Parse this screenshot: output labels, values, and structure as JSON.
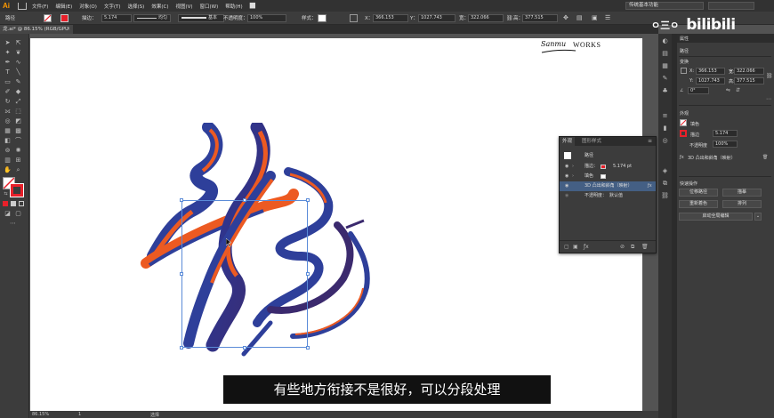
{
  "app": {
    "logo": "Ai",
    "document_tab": "龙.ai* @ 86.15% (RGB/GPU 预览)"
  },
  "menu": [
    "文件(F)",
    "编辑(E)",
    "对象(O)",
    "文字(T)",
    "选择(S)",
    "效果(C)",
    "视图(V)",
    "窗口(W)",
    "帮助(H)"
  ],
  "menu_extra": "█▌",
  "workspace": "传统基本功能",
  "control_bar": {
    "label": "路径",
    "stroke_label": "描边：",
    "stroke_value": "5.174",
    "stroke_style": "均匀",
    "brush": "基本",
    "opacity_label": "不透明度：",
    "opacity_value": "100%",
    "style_label": "样式：",
    "x_label": "X：",
    "x": "366.153",
    "y_label": "Y：",
    "y": "1027.743",
    "w_label": "宽：",
    "w": "322.066",
    "h_label": "高：",
    "h": "377.515"
  },
  "status_bar": {
    "zoom": "86.15%",
    "page": "1",
    "tool": "选择"
  },
  "signature": {
    "script": "Sanmu",
    "text": "WORKS"
  },
  "appearance_panel": {
    "tab_active": "外观",
    "tab_other": "图形样式",
    "object_label": "路径",
    "rows": [
      {
        "label": "描边：",
        "value": "5.174 pt"
      },
      {
        "label": "填色",
        "value": ""
      },
      {
        "label": "3D 凸出和斜角（映射）",
        "value": ""
      },
      {
        "label": "不透明度：",
        "value": "默认值"
      }
    ]
  },
  "properties": {
    "tab": "属性",
    "selection": "路径",
    "transform_title": "变换",
    "x": "366.153",
    "y": "1027.743",
    "w": "322.066",
    "h": "377.515",
    "angle": "0°",
    "appearance_title": "外观",
    "fill_label": "填色",
    "stroke_label": "描边",
    "stroke_value": "5.174",
    "opacity_label": "不透明度",
    "opacity_value": "100%",
    "fx_label": "3D 凸出和斜角（映射）",
    "quick_actions_title": "快速操作",
    "btn_offset": "位移路径",
    "btn_recolor": "重新着色",
    "btn_align": "描摹",
    "btn_arrange": "排列",
    "btn_global": "启动全局编辑"
  },
  "watermark": {
    "face": "ㅇ三ㅇ",
    "brand": "bilibili"
  },
  "subtitle": "有些地方衔接不是很好，可以分段处理",
  "colors": {
    "accent_red": "#e8202a",
    "dragon_blue": "#2e3f9a",
    "dragon_orange": "#ec5a22",
    "selection_blue": "#5a8bd8"
  }
}
